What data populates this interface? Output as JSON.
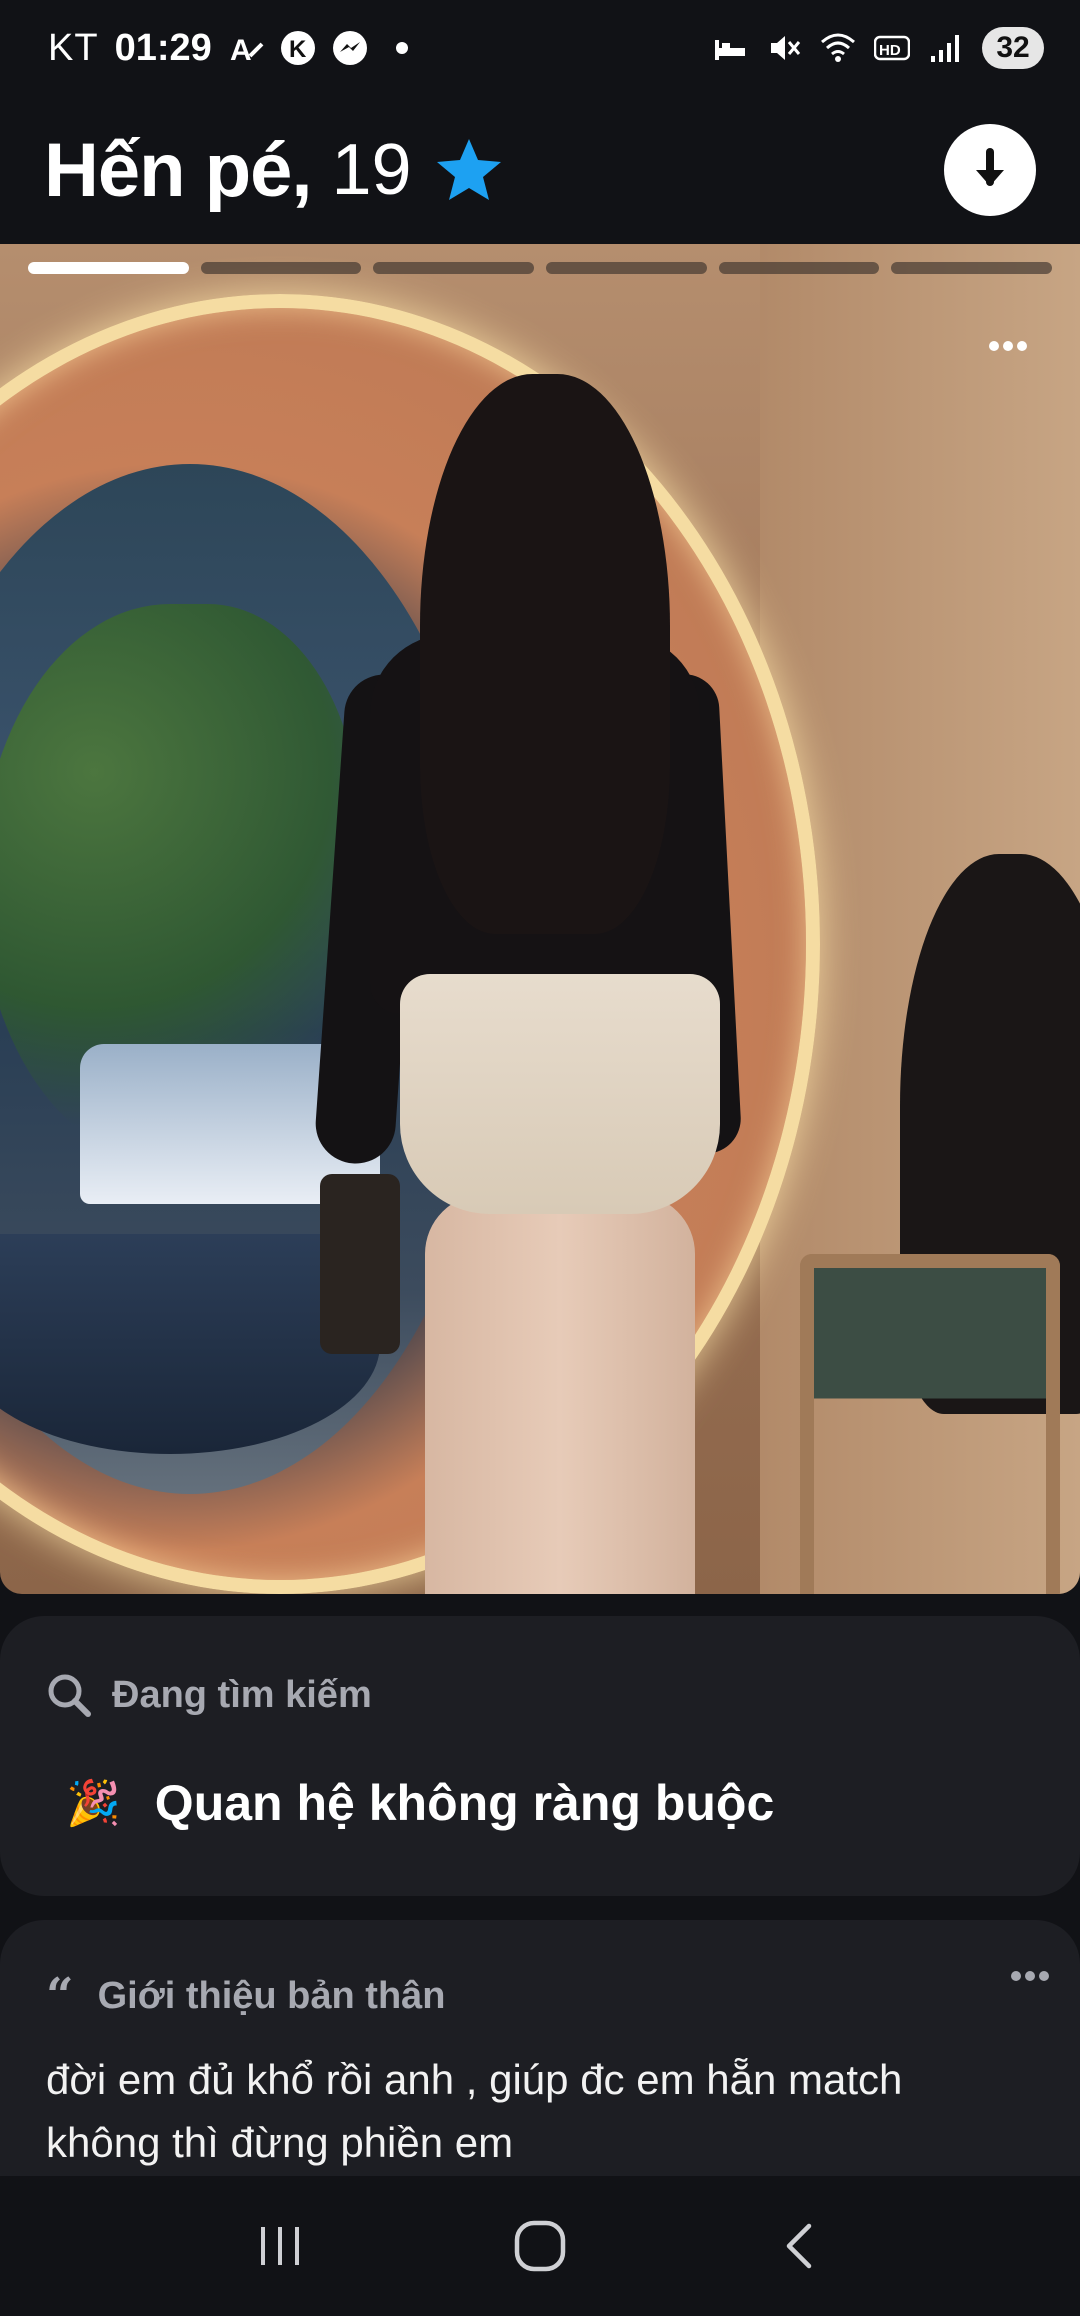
{
  "status_bar": {
    "carrier": "KT",
    "time": "01:29",
    "battery": "32",
    "left_icons": [
      "font-icon",
      "k-app-icon",
      "messenger-icon",
      "dot-icon"
    ],
    "right_icons": [
      "bed-icon",
      "mute-icon",
      "wifi-icon",
      "hd-icon",
      "signal-icon"
    ]
  },
  "profile": {
    "name": "Hến pé,",
    "age": "19",
    "verified": true
  },
  "photo": {
    "total_photos": 6,
    "active_index": 0
  },
  "looking_for": {
    "title": "Đang tìm kiếm",
    "value": "Quan hệ không ràng buộc",
    "emoji": "🎉"
  },
  "about": {
    "title": "Giới thiệu bản thân",
    "quote_mark": "“",
    "text": "đời em đủ khổ rồi anh , giúp đc em hẵn match không thì đừng phiền em"
  },
  "colors": {
    "background": "#111216",
    "card": "#1d1e23",
    "muted_text": "#a7a9b1",
    "verified_blue": "#1da1f2"
  }
}
